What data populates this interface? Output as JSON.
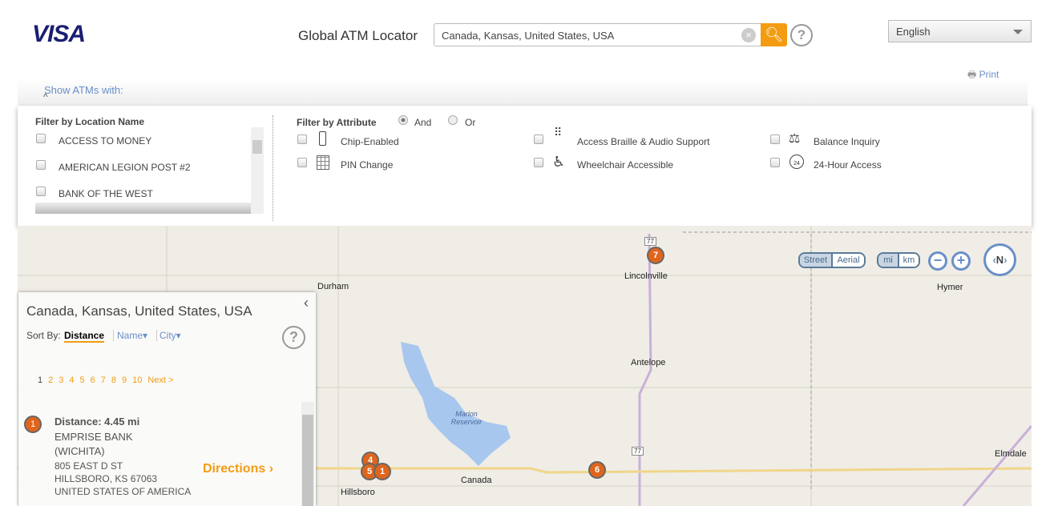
{
  "header": {
    "logo": "VISA",
    "title": "Global ATM Locator",
    "search_value": "Canada, Kansas, United States, USA",
    "language": "English",
    "print": "Print"
  },
  "filters": {
    "show_label": "Show ATMs with:",
    "location_heading": "Filter by Location Name",
    "locations": [
      "ACCESS TO MONEY",
      "AMERICAN LEGION POST #2",
      "BANK OF THE WEST"
    ],
    "attribute_heading": "Filter by Attribute",
    "and_label": "And",
    "or_label": "Or",
    "mode": "And",
    "attributes": [
      {
        "label": "Chip-Enabled",
        "icon": "chip-card-icon"
      },
      {
        "label": "PIN Change",
        "icon": "keypad-icon"
      },
      {
        "label": "Access Braille & Audio Support",
        "icon": "braille-icon"
      },
      {
        "label": "Wheelchair Accessible",
        "icon": "wheelchair-icon"
      },
      {
        "label": "Balance Inquiry",
        "icon": "scale-icon"
      },
      {
        "label": "24-Hour Access",
        "icon": "clock-24-icon"
      }
    ]
  },
  "map": {
    "view_street": "Street",
    "view_aerial": "Aerial",
    "unit_mi": "mi",
    "unit_km": "km",
    "compass": "N",
    "active_view": "Street",
    "active_unit": "mi",
    "places": [
      "Durham",
      "Lincolnville",
      "Antelope",
      "Hymer",
      "Canada",
      "Elmdale",
      "Hillsboro",
      "Marion Reservoir"
    ],
    "route": "77",
    "markers": [
      "7",
      "6",
      "4",
      "5",
      "1"
    ]
  },
  "results": {
    "title": "Canada, Kansas, United States, USA",
    "sort_by": "Sort By:",
    "sort_options": [
      "Distance",
      "Name",
      "City"
    ],
    "pages": [
      "1",
      "2",
      "3",
      "4",
      "5",
      "6",
      "7",
      "8",
      "9",
      "10",
      "Next >"
    ],
    "items": [
      {
        "num": "1",
        "distance": "Distance: 4.45 mi",
        "name": "EMPRISE BANK",
        "sub": "(WICHITA)",
        "address": "805 EAST D ST",
        "city": "HILLSBORO, KS 67063",
        "country": "UNITED STATES OF AMERICA",
        "directions": "Directions ›"
      }
    ]
  },
  "colors": {
    "brand": "#1a1f71",
    "accent": "#f39c12",
    "link": "#6a8fc8",
    "marker": "#e0651c"
  }
}
